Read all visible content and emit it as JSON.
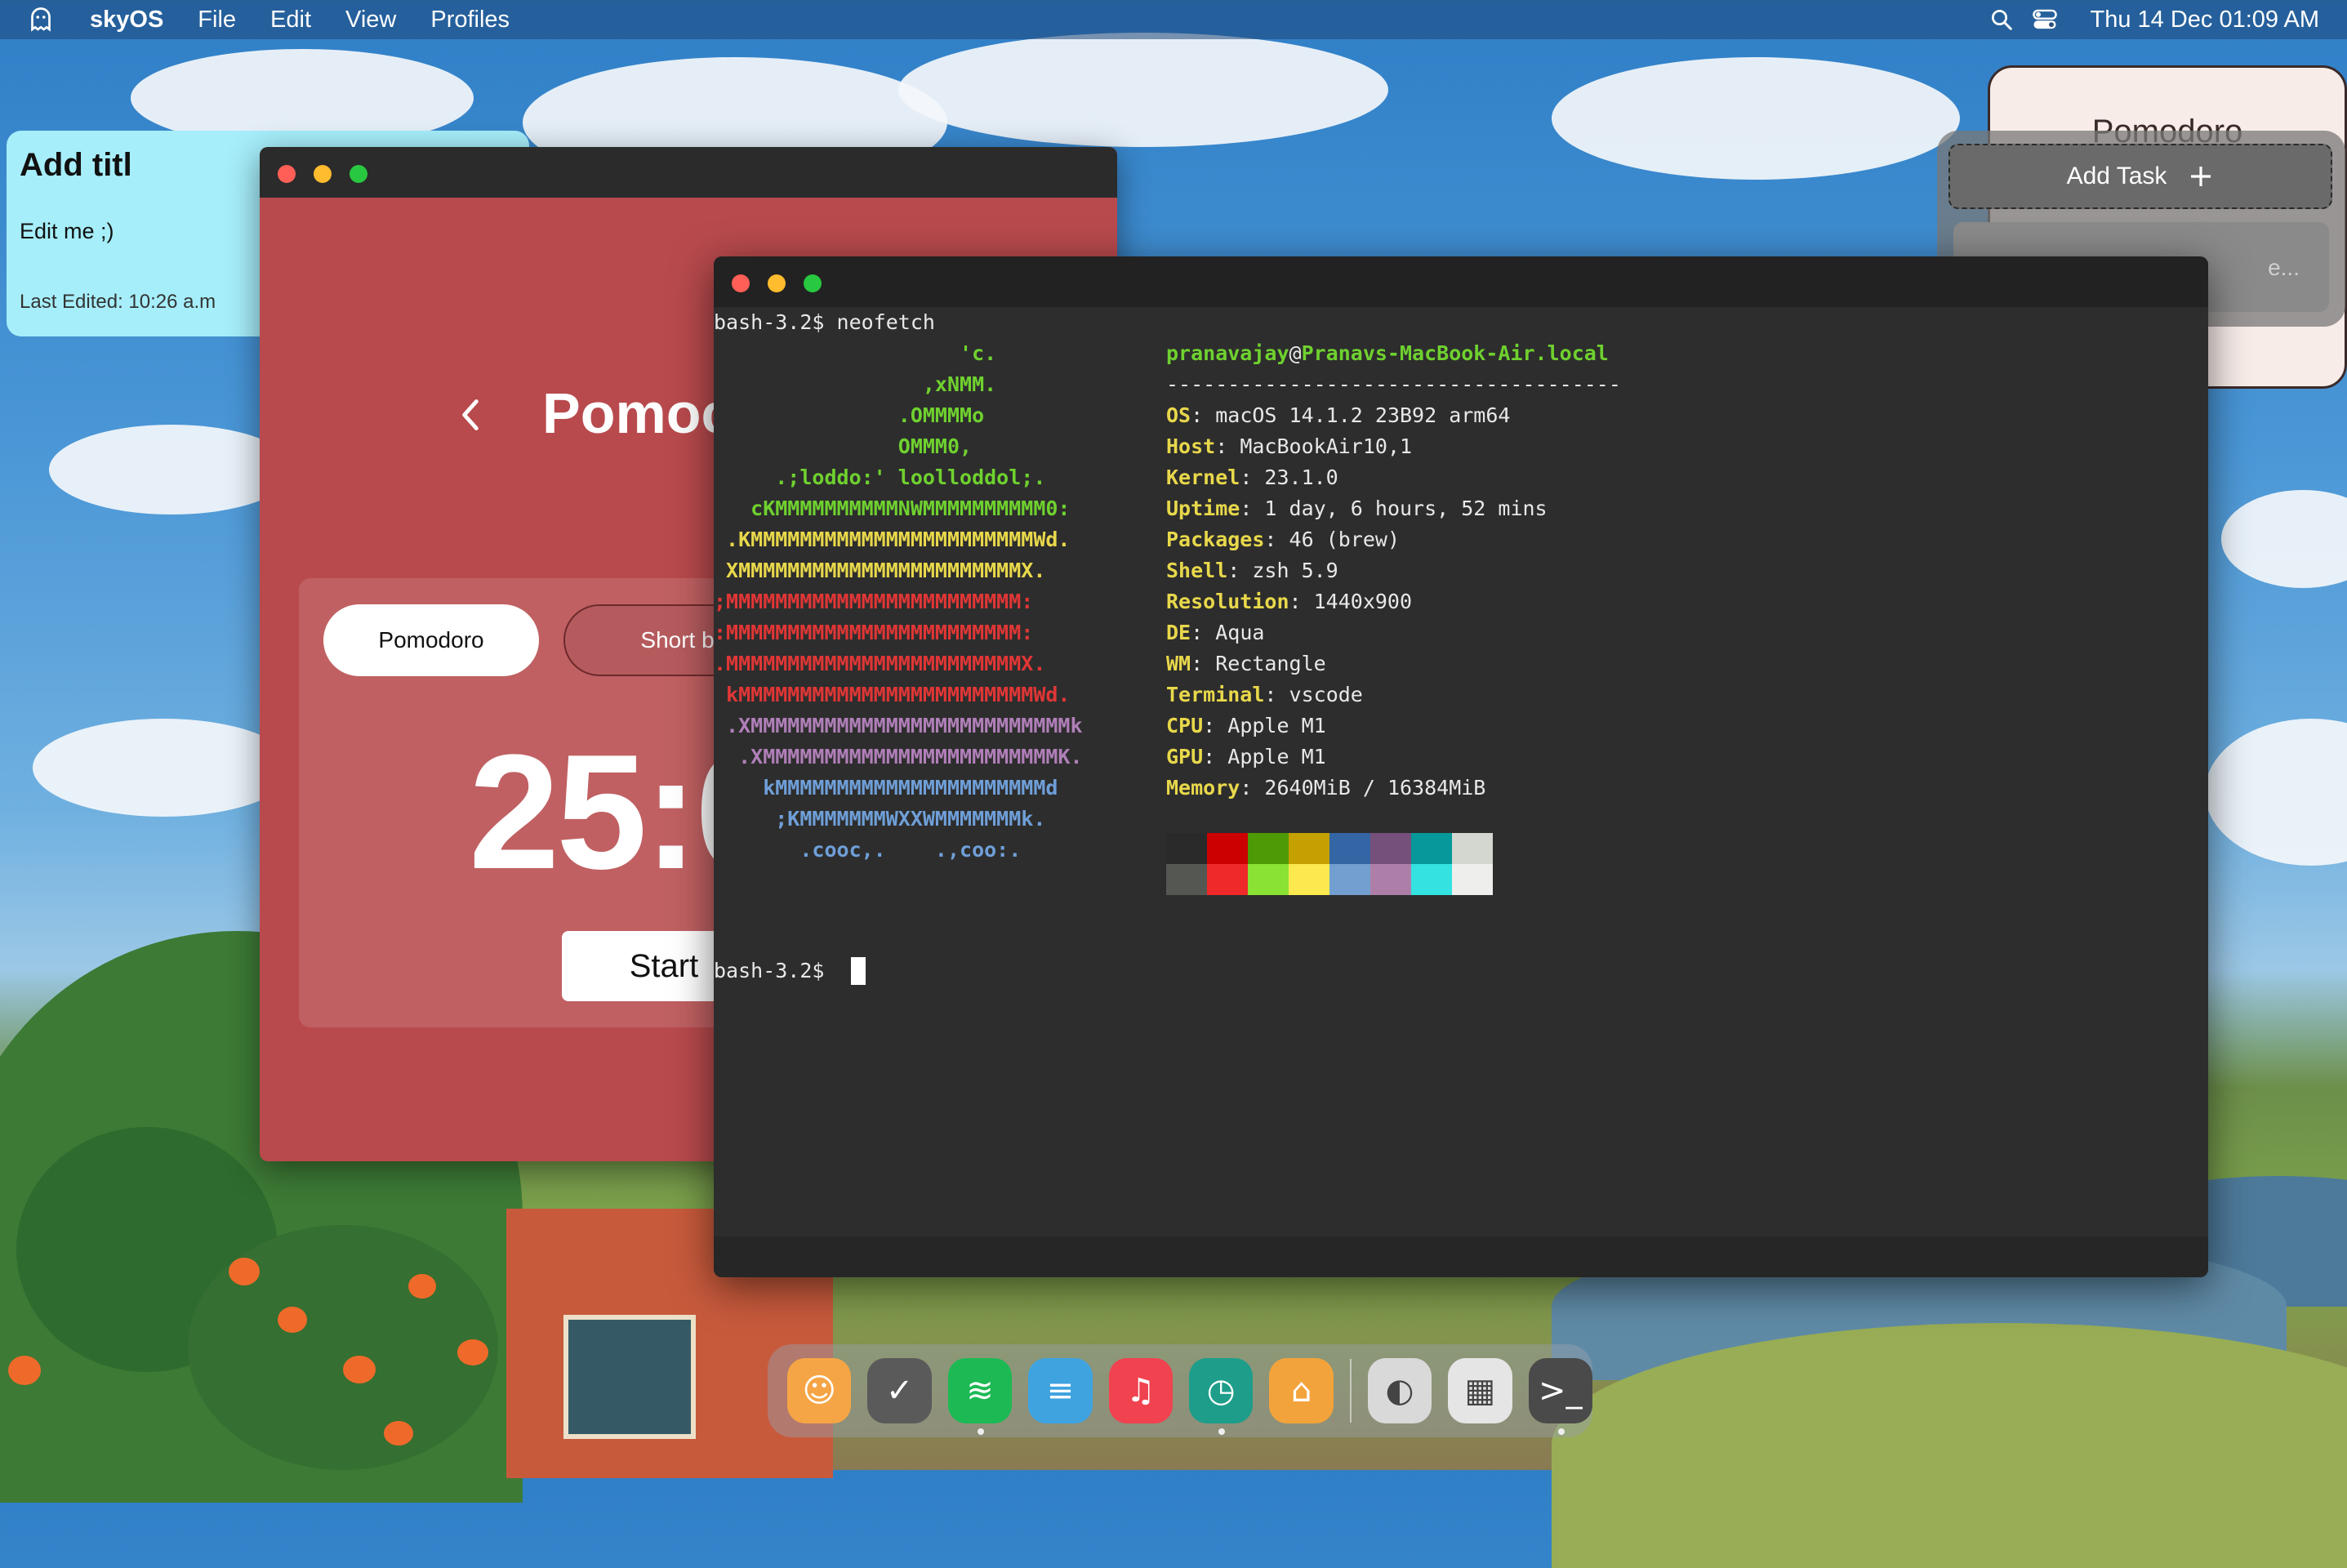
{
  "menubar": {
    "logo_icon": "ghost-icon",
    "brand": "skyOS",
    "menus": [
      "File",
      "Edit",
      "View",
      "Profiles"
    ],
    "datetime": "Thu 14 Dec  01:09 AM"
  },
  "note": {
    "title": "Add titl",
    "body": "Edit me ;)",
    "footer": "Last Edited: 10:26 a.m"
  },
  "widget": {
    "title": "Pomodoro",
    "add_task_label": "Add Task",
    "placeholder_text": "e..."
  },
  "pomodoro": {
    "title": "Pomoc",
    "tabs": [
      "Pomodoro",
      "Short bre"
    ],
    "timer": "25:0",
    "start_label": "Start"
  },
  "terminal": {
    "command_line": "bash-3.2$ neofetch",
    "prompt": "bash-3.2$ ",
    "user": "pranavajay",
    "host": "Pranavs-MacBook-Air.local",
    "separator": "-------------------------------------",
    "info": [
      {
        "key": "OS",
        "value": " macOS 14.1.2 23B92 arm64"
      },
      {
        "key": "Host",
        "value": " MacBookAir10,1"
      },
      {
        "key": "Kernel",
        "value": " 23.1.0"
      },
      {
        "key": "Uptime",
        "value": " 1 day, 6 hours, 52 mins"
      },
      {
        "key": "Packages",
        "value": " 46 (brew)"
      },
      {
        "key": "Shell",
        "value": " zsh 5.9"
      },
      {
        "key": "Resolution",
        "value": " 1440x900"
      },
      {
        "key": "DE",
        "value": " Aqua"
      },
      {
        "key": "WM",
        "value": " Rectangle"
      },
      {
        "key": "Terminal",
        "value": " vscode"
      },
      {
        "key": "CPU",
        "value": " Apple M1"
      },
      {
        "key": "GPU",
        "value": " Apple M1"
      },
      {
        "key": "Memory",
        "value": " 2640MiB / 16384MiB"
      }
    ],
    "ascii": [
      {
        "text": "                    'c.",
        "color": "#6fd12f"
      },
      {
        "text": "                 ,xNMM.",
        "color": "#6fd12f"
      },
      {
        "text": "               .OMMMMo",
        "color": "#6fd12f"
      },
      {
        "text": "               OMMM0,",
        "color": "#6fd12f"
      },
      {
        "text": "     .;loddo:' loolloddol;.",
        "color": "#6fd12f"
      },
      {
        "text": "   cKMMMMMMMMMMNWMMMMMMMMMM0:",
        "color": "#6fd12f"
      },
      {
        "text": " .KMMMMMMMMMMMMMMMMMMMMMMMWd.",
        "color": "#e8d84b"
      },
      {
        "text": " XMMMMMMMMMMMMMMMMMMMMMMMX.",
        "color": "#e8d84b"
      },
      {
        "text": ";MMMMMMMMMMMMMMMMMMMMMMMM:",
        "color": "#e03636"
      },
      {
        "text": ":MMMMMMMMMMMMMMMMMMMMMMMM:",
        "color": "#e03636"
      },
      {
        "text": ".MMMMMMMMMMMMMMMMMMMMMMMMX.",
        "color": "#e03636"
      },
      {
        "text": " kMMMMMMMMMMMMMMMMMMMMMMMMWd.",
        "color": "#e03636"
      },
      {
        "text": " .XMMMMMMMMMMMMMMMMMMMMMMMMMMk",
        "color": "#b07fb8"
      },
      {
        "text": "  .XMMMMMMMMMMMMMMMMMMMMMMMMK.",
        "color": "#b07fb8"
      },
      {
        "text": "    kMMMMMMMMMMMMMMMMMMMMMMd",
        "color": "#6f9fd8"
      },
      {
        "text": "     ;KMMMMMMMWXXWMMMMMMMk.",
        "color": "#6f9fd8"
      },
      {
        "text": "       .cooc,.    .,coo:.",
        "color": "#6f9fd8"
      }
    ],
    "palette_top": [
      "#2a2a2a",
      "#cc0000",
      "#4e9a06",
      "#c4a000",
      "#3465a4",
      "#75507b",
      "#06989a",
      "#d3d7cf"
    ],
    "palette_bottom": [
      "#555753",
      "#ef2929",
      "#8ae234",
      "#fce94f",
      "#729fcf",
      "#ad7fa8",
      "#34e2e2",
      "#eeeeec"
    ]
  },
  "dock": {
    "apps": [
      {
        "name": "finder-app-icon",
        "bg": "#f5a545",
        "glyph": "☺",
        "running": false
      },
      {
        "name": "notes-clipboard-app-icon",
        "bg": "#5a5a5a",
        "glyph": "✓",
        "running": false
      },
      {
        "name": "spotify-app-icon",
        "bg": "#1db954",
        "glyph": "≋",
        "running": true
      },
      {
        "name": "text-editor-app-icon",
        "bg": "#3fa3e0",
        "glyph": "≡",
        "running": false
      },
      {
        "name": "music-app-icon",
        "bg": "#f0424f",
        "glyph": "♫",
        "running": false
      },
      {
        "name": "clock-app-icon",
        "bg": "#1e9e8a",
        "glyph": "◷",
        "running": true
      },
      {
        "name": "app-store-icon",
        "bg": "#f3a33b",
        "glyph": "⌂",
        "running": false
      },
      {
        "name": "settings-toggle-app-icon",
        "bg": "#d9d9d9",
        "glyph": "◐",
        "running": false
      },
      {
        "name": "launchpad-app-icon",
        "bg": "#e5e5e5",
        "glyph": "▦",
        "running": false
      },
      {
        "name": "terminal-app-icon",
        "bg": "#4a4a4a",
        "glyph": ">_",
        "running": true
      }
    ]
  }
}
